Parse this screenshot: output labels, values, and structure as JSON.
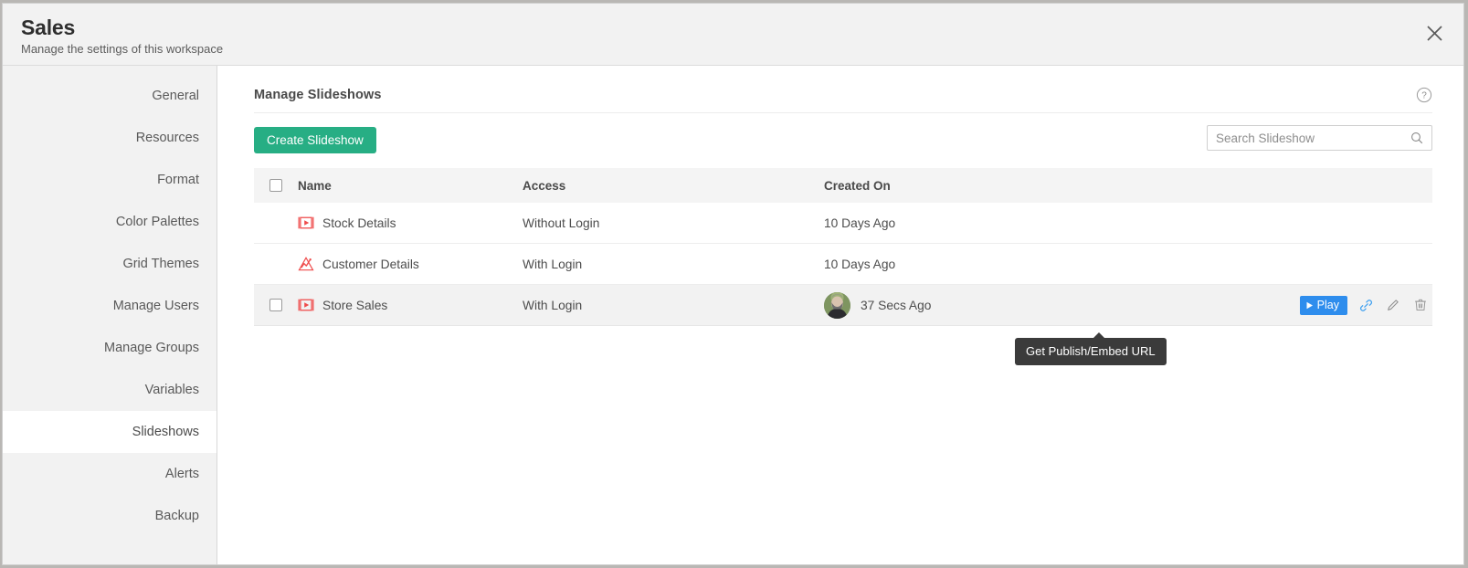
{
  "window": {
    "title": "Sales",
    "subtitle": "Manage the settings of this workspace",
    "close_label": "close-icon"
  },
  "sidebar": {
    "items": [
      {
        "label": "General",
        "active": false
      },
      {
        "label": "Resources",
        "active": false
      },
      {
        "label": "Format",
        "active": false
      },
      {
        "label": "Color Palettes",
        "active": false
      },
      {
        "label": "Grid Themes",
        "active": false
      },
      {
        "label": "Manage Users",
        "active": false
      },
      {
        "label": "Manage Groups",
        "active": false
      },
      {
        "label": "Variables",
        "active": false
      },
      {
        "label": "Slideshows",
        "active": true
      },
      {
        "label": "Alerts",
        "active": false
      },
      {
        "label": "Backup",
        "active": false
      }
    ]
  },
  "content": {
    "title": "Manage Slideshows",
    "help_icon": "help-circle-icon"
  },
  "toolbar": {
    "create_label": "Create Slideshow",
    "search_placeholder": "Search Slideshow",
    "search_value": "",
    "search_icon": "search-icon"
  },
  "table": {
    "columns": {
      "name": "Name",
      "access": "Access",
      "created": "Created On"
    },
    "rows": [
      {
        "name": "Stock Details",
        "access": "Without Login",
        "created": "10 Days Ago",
        "icon": "slideshow-icon",
        "has_checkbox": false,
        "has_avatar": false,
        "hovered": false
      },
      {
        "name": "Customer Details",
        "access": "With Login",
        "created": "10 Days Ago",
        "icon": "chart-icon",
        "has_checkbox": false,
        "has_avatar": false,
        "hovered": false
      },
      {
        "name": "Store Sales",
        "access": "With Login",
        "created": "37 Secs Ago",
        "icon": "slideshow-icon",
        "has_checkbox": true,
        "has_avatar": true,
        "hovered": true
      }
    ]
  },
  "row_actions": {
    "play_label": "Play",
    "play_icon": "play-triangle-icon",
    "link_icon": "link-icon",
    "edit_icon": "pencil-icon",
    "delete_icon": "trash-icon"
  },
  "tooltip": {
    "text": "Get Publish/Embed URL"
  },
  "colors": {
    "accent_green": "#27ae84",
    "accent_blue": "#2e8ded",
    "row_icon_red": "#ef4b4b",
    "tooltip_bg": "#3b3b3b",
    "sidebar_bg": "#f2f2f2"
  }
}
